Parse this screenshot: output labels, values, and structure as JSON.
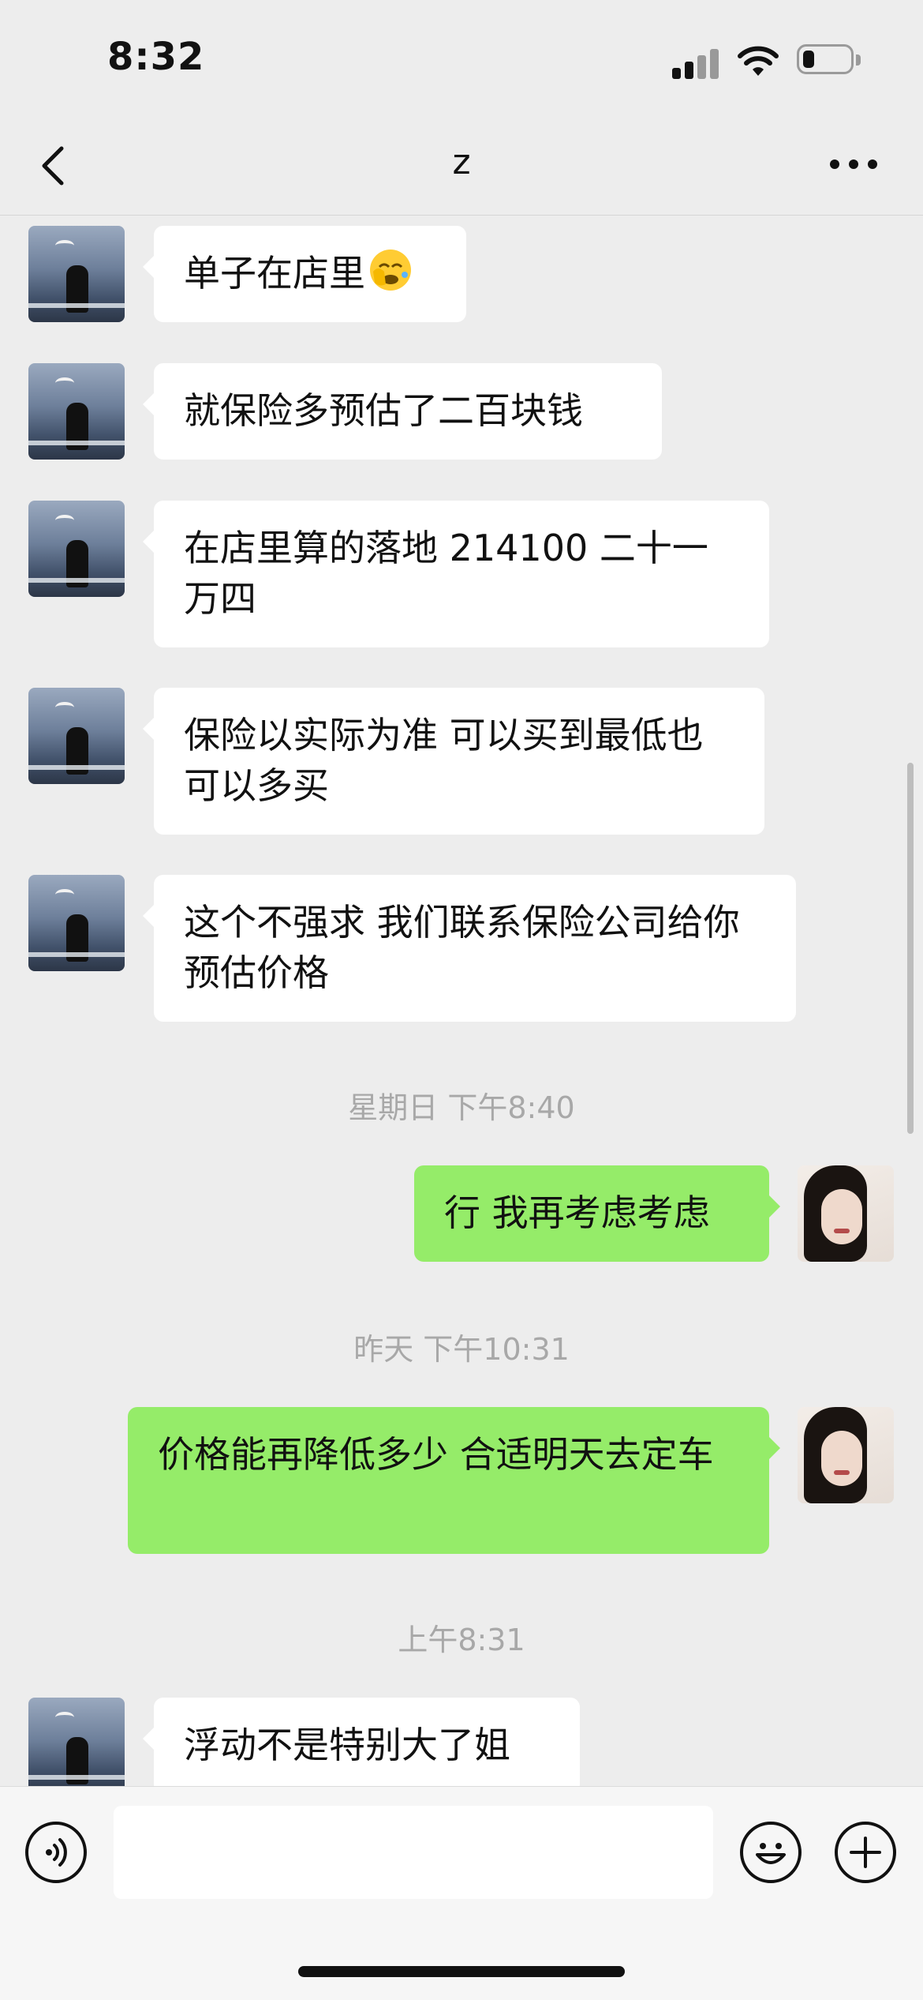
{
  "status_bar": {
    "time": "8:32"
  },
  "chat": {
    "title": "z"
  },
  "messages": [
    {
      "side": "left",
      "text": "单子在店里",
      "emoji": "face-with-hand-over-eyes-emoji"
    },
    {
      "side": "left",
      "text": "就保险多预估了二百块钱"
    },
    {
      "side": "left",
      "text": "在店里算的落地 214100 二十一万四"
    },
    {
      "side": "left",
      "text": "保险以实际为准 可以买到最低也可以多买"
    },
    {
      "side": "left",
      "text": "这个不强求 我们联系保险公司给你预估价格"
    },
    {
      "side": "right",
      "text": "行 我再考虑考虑"
    },
    {
      "side": "right",
      "text": "价格能再降低多少 合适明天去定车"
    },
    {
      "side": "left",
      "text": "浮动不是特别大了姐"
    }
  ],
  "timestamps": [
    "星期日 下午8:40",
    "昨天 下午10:31",
    "上午8:31"
  ],
  "input": {
    "placeholder": ""
  },
  "colors": {
    "background": "#ededed",
    "peer_bubble": "#ffffff",
    "self_bubble": "#95ec69",
    "timestamp": "#a8a8a8"
  },
  "icons": {
    "back": "chevron-left-icon",
    "more": "more-dots-icon",
    "voice": "voice-icon",
    "emoji": "smile-emoji-icon",
    "add": "plus-circle-icon"
  }
}
